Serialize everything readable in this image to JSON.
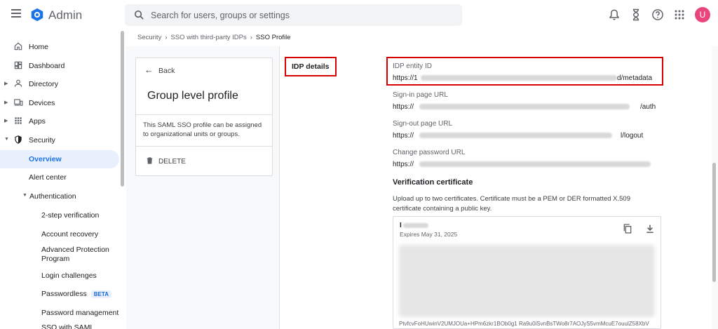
{
  "header": {
    "app_title": "Admin",
    "search_placeholder": "Search for users, groups or settings",
    "avatar_letter": "U",
    "avatar_color": "#e8467c"
  },
  "sidebar": {
    "items": [
      {
        "label": "Home",
        "icon": "home-icon"
      },
      {
        "label": "Dashboard",
        "icon": "dashboard-icon"
      },
      {
        "label": "Directory",
        "icon": "person-icon"
      },
      {
        "label": "Devices",
        "icon": "devices-icon"
      },
      {
        "label": "Apps",
        "icon": "apps-grid-icon"
      },
      {
        "label": "Security",
        "icon": "shield-icon"
      },
      {
        "label": "Overview"
      },
      {
        "label": "Alert center"
      },
      {
        "label": "Authentication"
      },
      {
        "label": "2-step verification"
      },
      {
        "label": "Account recovery"
      },
      {
        "label": "Advanced Protection Program"
      },
      {
        "label": "Login challenges"
      },
      {
        "label": "Passwordless",
        "badge": "BETA"
      },
      {
        "label": "Password management"
      },
      {
        "label": "SSO with SAML"
      }
    ]
  },
  "breadcrumb": [
    "Security",
    "SSO with third-party IDPs",
    "SSO Profile"
  ],
  "profile_card": {
    "back_label": "Back",
    "title": "Group level profile",
    "description": "This SAML SSO profile can be assigned to organizational units or groups.",
    "delete_label": "DELETE"
  },
  "idp": {
    "section_label": "IDP details",
    "fields": [
      {
        "label": "IDP entity ID",
        "value_start": "https://1",
        "value_end": "d/metadata"
      },
      {
        "label": "Sign-in page URL",
        "value_start": "https://",
        "value_end": "/auth"
      },
      {
        "label": "Sign-out page URL",
        "value_start": "https://",
        "value_end": "l/logout"
      },
      {
        "label": "Change password URL",
        "value_start": "https://",
        "value_end": ""
      }
    ]
  },
  "certificate": {
    "title": "Verification certificate",
    "description": "Upload up to two certificates. Certificate must be a PEM or DER formatted X.509 certificate containing a public key.",
    "name": "I",
    "expires": "Expires May 31, 2025",
    "tail_line": "PtvfcvFoHUwinV2UMJOUa+HPm6zkr1BOb0g1 Ra9u0iSvnBsTWo8r7AOJyS5vmMcuE7ouulZ58XbV"
  },
  "colors": {
    "accent": "#1a73e8",
    "highlight": "#d50000"
  }
}
